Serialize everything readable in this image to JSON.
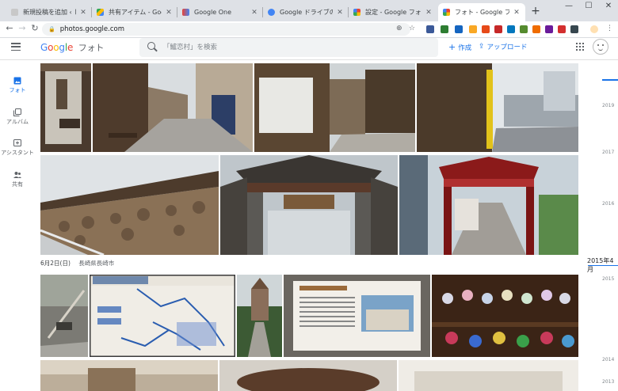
{
  "browser": {
    "tabs": [
      {
        "title": "新規投稿を追加 ‹ しもた帳 —",
        "favicon_color": "#9e9e9e",
        "active": false
      },
      {
        "title": "共有アイテム - Google ドライ",
        "favicon_color": "#34a853",
        "active": false
      },
      {
        "title": "Google One",
        "favicon_color": "#ea4335",
        "active": false
      },
      {
        "title": "Google ドライブの保存容量",
        "favicon_color": "#4285f4",
        "active": false
      },
      {
        "title": "設定 - Google フォト",
        "favicon_color": "#fbbc05",
        "active": false
      },
      {
        "title": "フォト - Google フォト",
        "favicon_color": "#ea4335",
        "active": true
      }
    ],
    "new_tab_label": "+",
    "window_controls": {
      "minimize": "—",
      "maximize": "☐",
      "close": "✕"
    },
    "back_icon": "←",
    "forward_icon": "→",
    "reload_icon": "↻",
    "lock_icon": "🔒",
    "url": "photos.google.com",
    "bookmark_icon": "☆"
  },
  "app": {
    "logo": {
      "g1": "G",
      "g2": "o",
      "g3": "o",
      "g4": "g",
      "g5": "l",
      "g6": "e",
      "app_name": "フォト"
    },
    "search": {
      "placeholder": "「鱸恋村」を検索"
    },
    "create_label": "作成",
    "upload_label": "アップロード",
    "create_icon": "+",
    "upload_icon": "⇪"
  },
  "nav": [
    {
      "label": "フォト",
      "icon": "photo-icon",
      "active": true
    },
    {
      "label": "アルバム",
      "icon": "album-icon",
      "active": false
    },
    {
      "label": "アシスタント",
      "icon": "assistant-icon",
      "active": false
    },
    {
      "label": "共有",
      "icon": "sharing-icon",
      "active": false
    }
  ],
  "section": {
    "date": "6月2日(日)",
    "location": "長崎県長崎市"
  },
  "timeline": {
    "current": "2015年4月",
    "years": [
      "2019",
      "2017",
      "2016",
      "2015",
      "2014",
      "2013"
    ]
  },
  "colors": {
    "accent": "#1a73e8"
  }
}
